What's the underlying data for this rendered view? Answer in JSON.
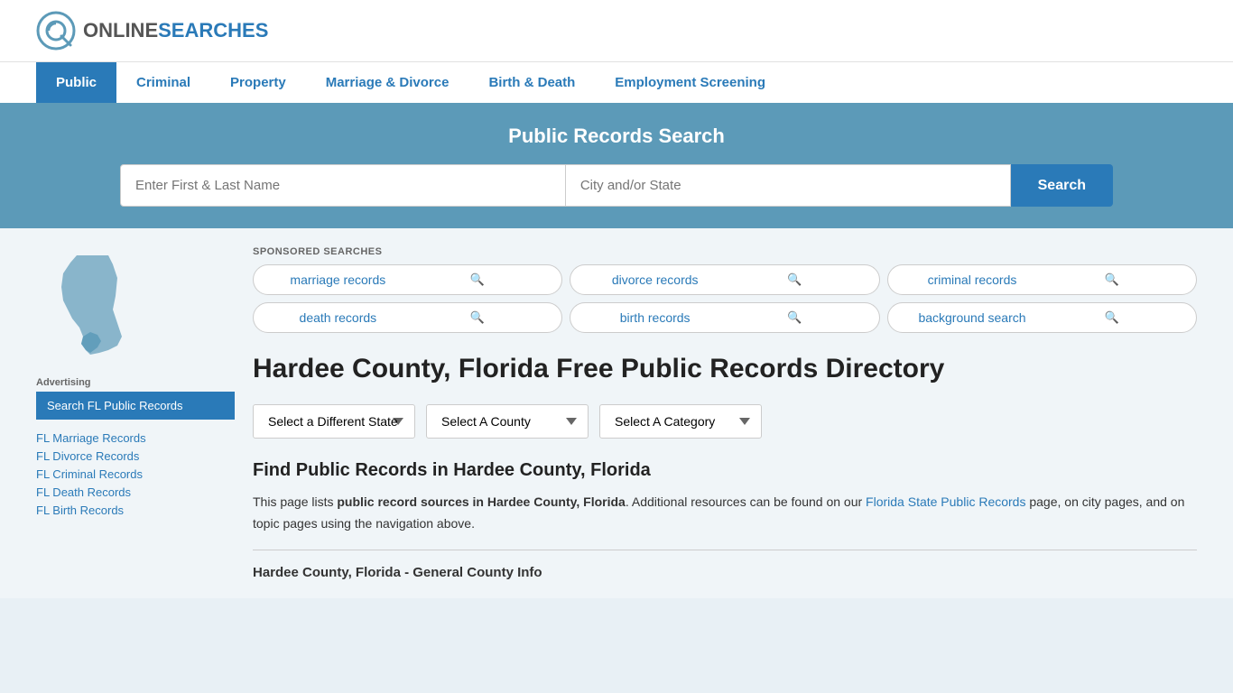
{
  "header": {
    "logo_online": "ONLINE",
    "logo_searches": "SEARCHES"
  },
  "nav": {
    "items": [
      {
        "label": "Public",
        "active": true
      },
      {
        "label": "Criminal",
        "active": false
      },
      {
        "label": "Property",
        "active": false
      },
      {
        "label": "Marriage & Divorce",
        "active": false
      },
      {
        "label": "Birth & Death",
        "active": false
      },
      {
        "label": "Employment Screening",
        "active": false
      }
    ]
  },
  "hero": {
    "title": "Public Records Search",
    "name_placeholder": "Enter First & Last Name",
    "location_placeholder": "City and/or State",
    "search_button": "Search"
  },
  "sponsored": {
    "label": "SPONSORED SEARCHES",
    "items": [
      {
        "label": "marriage records"
      },
      {
        "label": "divorce records"
      },
      {
        "label": "criminal records"
      },
      {
        "label": "death records"
      },
      {
        "label": "birth records"
      },
      {
        "label": "background search"
      }
    ]
  },
  "page": {
    "title": "Hardee County, Florida Free Public Records Directory",
    "dropdowns": {
      "state": "Select a Different State",
      "county": "Select A County",
      "category": "Select A Category"
    },
    "find_title": "Find Public Records in Hardee County, Florida",
    "find_body_part1": "This page lists ",
    "find_body_bold": "public record sources in Hardee County, Florida",
    "find_body_part2": ". Additional resources can be found on our ",
    "find_link_text": "Florida State Public Records",
    "find_body_part3": " page, on city pages, and on topic pages using the navigation above.",
    "county_info_label": "Hardee County, Florida - General County Info"
  },
  "sidebar": {
    "ad_label": "Advertising",
    "search_btn": "Search FL Public Records",
    "links": [
      {
        "label": "FL Marriage Records"
      },
      {
        "label": "FL Divorce Records"
      },
      {
        "label": "FL Criminal Records"
      },
      {
        "label": "FL Death Records"
      },
      {
        "label": "FL Birth Records"
      }
    ]
  }
}
